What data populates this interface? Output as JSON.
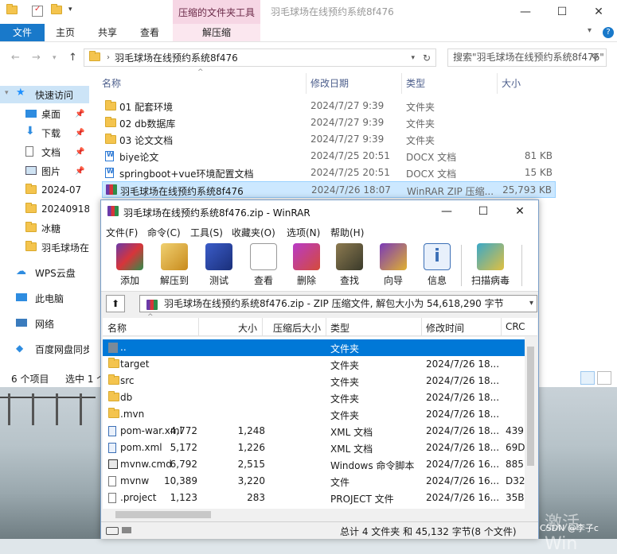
{
  "explorer": {
    "tool_tab_header": "压缩的文件夹工具",
    "window_title": "羽毛球场在线预约系统8f476",
    "ribbon_tabs": [
      "文件",
      "主页",
      "共享",
      "查看"
    ],
    "tool_tab": "解压缩",
    "address_crumb": "羽毛球场在线预约系统8f476",
    "search_placeholder": "搜索\"羽毛球场在线预约系统8f476\"",
    "columns": {
      "name": "名称",
      "date": "修改日期",
      "type": "类型",
      "size": "大小"
    },
    "nav": {
      "quick_access": "快速访问",
      "items": [
        {
          "label": "桌面",
          "pin": "📌"
        },
        {
          "label": "下载",
          "pin": "📌"
        },
        {
          "label": "文档",
          "pin": "📌"
        },
        {
          "label": "图片",
          "pin": "📌"
        },
        {
          "label": "2024-07"
        },
        {
          "label": "20240918"
        },
        {
          "label": "冰糖"
        },
        {
          "label": "羽毛球场在"
        }
      ],
      "wps": "WPS云盘",
      "pc": "此电脑",
      "network": "网络",
      "baidu": "百度网盘同步"
    },
    "files": [
      {
        "name": "01 配套环境",
        "date": "2024/7/27 9:39",
        "type": "文件夹",
        "size": ""
      },
      {
        "name": "02 db数据库",
        "date": "2024/7/27 9:39",
        "type": "文件夹",
        "size": ""
      },
      {
        "name": "03 论文文档",
        "date": "2024/7/27 9:39",
        "type": "文件夹",
        "size": ""
      },
      {
        "name": "biye论文",
        "date": "2024/7/25 20:51",
        "type": "DOCX 文档",
        "size": "81 KB"
      },
      {
        "name": "springboot+vue环境配置文档",
        "date": "2024/7/25 20:51",
        "type": "DOCX 文档",
        "size": "15 KB"
      },
      {
        "name": "羽毛球场在线预约系统8f476",
        "date": "2024/7/26 18:07",
        "type": "WinRAR ZIP 压缩...",
        "size": "25,793 KB"
      }
    ],
    "status": {
      "count": "6 个项目",
      "selected": "选中 1 个"
    }
  },
  "rar": {
    "title": "羽毛球场在线预约系统8f476.zip - WinRAR",
    "menu": [
      "文件(F)",
      "命令(C)",
      "工具(S)",
      "收藏夹(O)",
      "选项(N)",
      "帮助(H)"
    ],
    "tools": [
      "添加",
      "解压到",
      "测试",
      "查看",
      "删除",
      "查找",
      "向导",
      "信息",
      "扫描病毒"
    ],
    "path": "羽毛球场在线预约系统8f476.zip - ZIP 压缩文件, 解包大小为 54,618,290 字节",
    "columns": {
      "name": "名称",
      "size": "大小",
      "packed": "压缩后大小",
      "type": "类型",
      "modified": "修改时间",
      "crc": "CRC"
    },
    "rows": [
      {
        "name": "..",
        "size": "",
        "packed": "",
        "type": "文件夹",
        "modified": "",
        "crc": ""
      },
      {
        "name": "target",
        "size": "",
        "packed": "",
        "type": "文件夹",
        "modified": "2024/7/26 18...",
        "crc": ""
      },
      {
        "name": "src",
        "size": "",
        "packed": "",
        "type": "文件夹",
        "modified": "2024/7/26 18...",
        "crc": ""
      },
      {
        "name": "db",
        "size": "",
        "packed": "",
        "type": "文件夹",
        "modified": "2024/7/26 18...",
        "crc": ""
      },
      {
        "name": ".mvn",
        "size": "",
        "packed": "",
        "type": "文件夹",
        "modified": "2024/7/26 18...",
        "crc": ""
      },
      {
        "name": "pom-war.xml",
        "size": "4,772",
        "packed": "1,248",
        "type": "XML 文档",
        "modified": "2024/7/26 18...",
        "crc": "439"
      },
      {
        "name": "pom.xml",
        "size": "5,172",
        "packed": "1,226",
        "type": "XML 文档",
        "modified": "2024/7/26 18...",
        "crc": "69D"
      },
      {
        "name": "mvnw.cmd",
        "size": "6,792",
        "packed": "2,515",
        "type": "Windows 命令脚本",
        "modified": "2024/7/26 16...",
        "crc": "885"
      },
      {
        "name": "mvnw",
        "size": "10,389",
        "packed": "3,220",
        "type": "文件",
        "modified": "2024/7/26 16...",
        "crc": "D32"
      },
      {
        "name": ".project",
        "size": "1,123",
        "packed": "283",
        "type": "PROJECT 文件",
        "modified": "2024/7/26 16...",
        "crc": "35B"
      }
    ],
    "status": "总计 4 文件夹 和 45,132 字节(8 个文件)"
  },
  "watermark": "激活 Win",
  "csdn": "CSDN @李子c"
}
